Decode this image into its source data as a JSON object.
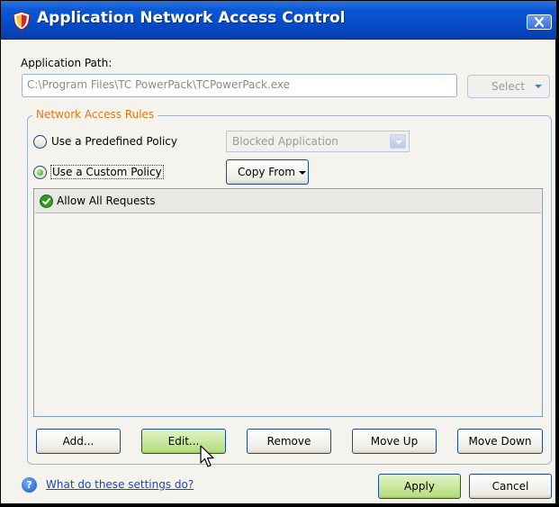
{
  "window": {
    "title": "Application Network Access Control",
    "title_icon": "shield-icon",
    "close_icon": "close-icon"
  },
  "app_path": {
    "label": "Application Path:",
    "value": "C:\\Program Files\\TC PowerPack\\TCPowerPack.exe",
    "select_label": "Select"
  },
  "rules": {
    "group_title": "Network Access Rules",
    "predefined_label": "Use a Predefined Policy",
    "predefined_selected": false,
    "predefined_value": "Blocked Application",
    "custom_label": "Use a Custom Policy",
    "custom_selected": true,
    "copy_from_label": "Copy From",
    "items": [
      {
        "label": "Allow All Requests",
        "icon": "green-check-icon"
      }
    ]
  },
  "buttons": {
    "add": "Add...",
    "edit": "Edit...",
    "remove": "Remove",
    "move_up": "Move Up",
    "move_down": "Move Down",
    "apply": "Apply",
    "cancel": "Cancel"
  },
  "help": {
    "link": "What do these settings do?",
    "icon": "help-icon"
  },
  "colors": {
    "titlebar": "#0548c4",
    "group_title": "#e8760e",
    "link": "#1b45c8",
    "focused_button": "#b9dd82"
  }
}
